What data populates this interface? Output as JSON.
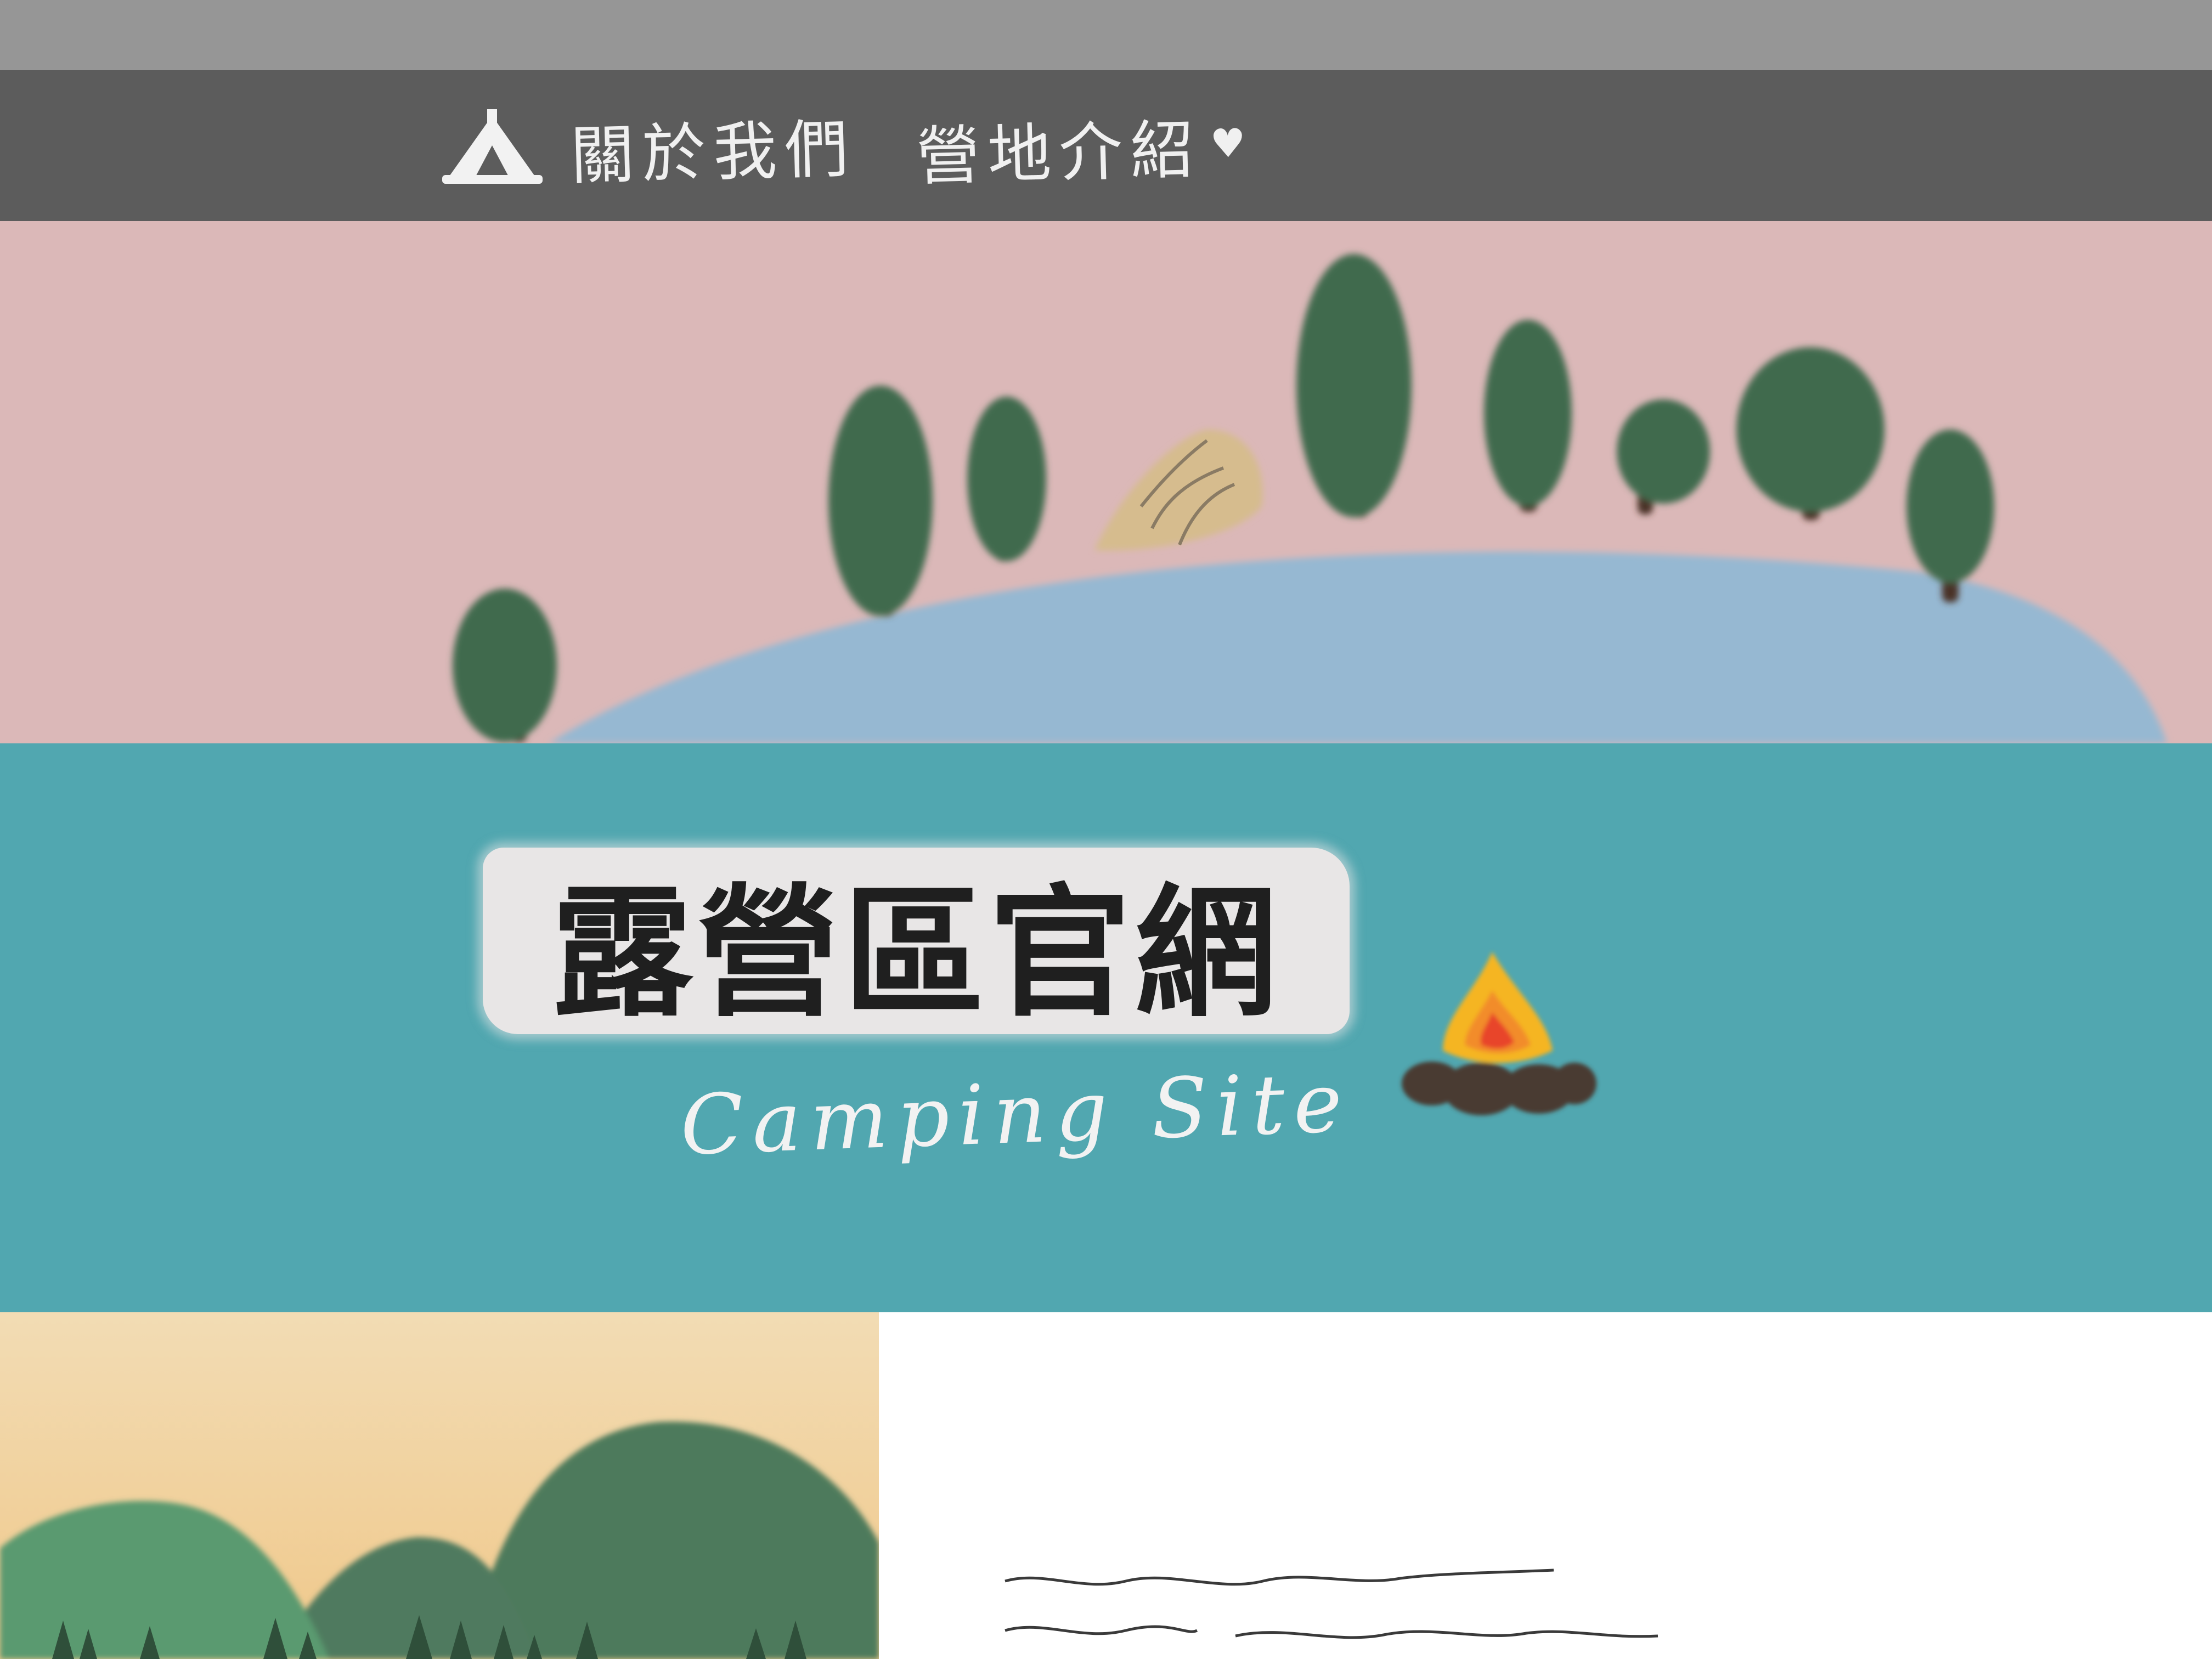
{
  "nav": {
    "items": [
      {
        "label": "關於我們"
      },
      {
        "label": "營地介紹",
        "suffix": "♥"
      }
    ]
  },
  "hero": {
    "title": "露營區官網",
    "subtitle": "Camping Site"
  },
  "intro": {
    "heading": "",
    "paragraph": ""
  },
  "colors": {
    "top_strip": "#969696",
    "navbar": "#5c5c5c",
    "sky_pink": "#dbb8b8",
    "hill_blue": "#96b8d2",
    "band_teal": "#51a7b0",
    "tree_green": "#3f6a4e",
    "tent": "#d6bc8e"
  },
  "icons": {
    "logo": "tent-icon",
    "campfire": "campfire-icon",
    "heart": "heart-icon"
  }
}
